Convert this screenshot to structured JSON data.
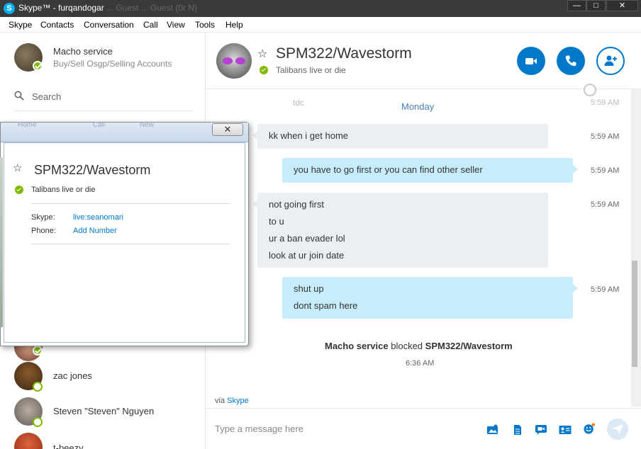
{
  "window": {
    "title": "Skype™ - furqandogar",
    "ghost_text": "... Guest ... Guest (0r N)",
    "minimize": "—",
    "maximize": "□",
    "close": "✕"
  },
  "menu": [
    "Skype",
    "Contacts",
    "Conversation",
    "Call",
    "View",
    "Tools",
    "Help"
  ],
  "profile": {
    "name": "Macho service",
    "mood": "Buy/Sell Osgp/Selling Accounts"
  },
  "search": {
    "label": "Search"
  },
  "contacts": [
    {
      "name": "zac jones"
    },
    {
      "name": "Steven \"Steven\" Nguyen"
    },
    {
      "name": "t-beezy"
    }
  ],
  "conversation": {
    "name": "SPM322/Wavestorm",
    "mood": "Talibans live or die",
    "day_label": "Monday",
    "ghost_above": "tdc",
    "ghost_time": "5:59 AM",
    "messages": [
      {
        "direction": "in",
        "lines": [
          "kk when i get home"
        ],
        "time": "5:59 AM"
      },
      {
        "direction": "out",
        "lines": [
          "you have to go first or you can find other seller"
        ],
        "time": "5:59 AM"
      },
      {
        "direction": "in",
        "lines": [
          "not going first",
          "to u",
          "ur a ban evader lol",
          "look at ur join date"
        ],
        "time": "5:59 AM"
      },
      {
        "direction": "out",
        "lines": [
          "shut up",
          "dont spam here"
        ],
        "time": "5:59 AM"
      }
    ],
    "system_event": {
      "actor": "Macho service",
      "action": " blocked ",
      "target": "SPM322/Wavestorm",
      "time": "6:36 AM"
    },
    "via_prefix": "via ",
    "via_link": "Skype",
    "composer_placeholder": "Type a message here"
  },
  "popup": {
    "close": "✕",
    "name": "SPM322/Wavestorm",
    "mood": "Talibans live or die",
    "skype_label": "Skype:",
    "skype_value": "live:seanomari",
    "phone_label": "Phone:",
    "phone_value": "Add Number",
    "ghost_tabs": [
      "Home",
      "Call",
      "New"
    ]
  },
  "colors": {
    "accent": "#0078ca",
    "online": "#7fba00",
    "bubble_out": "#c7edfc",
    "bubble_in": "#eceff1",
    "titlebar": "#3a3a3a"
  },
  "icons": {
    "video_call": "video-camera-icon",
    "voice_call": "phone-icon",
    "add_people": "add-person-icon",
    "favorite": "star-outline-icon",
    "composer": [
      "image-icon",
      "file-icon",
      "video-message-icon",
      "contact-card-icon",
      "emoticon-icon",
      "send-icon"
    ]
  }
}
